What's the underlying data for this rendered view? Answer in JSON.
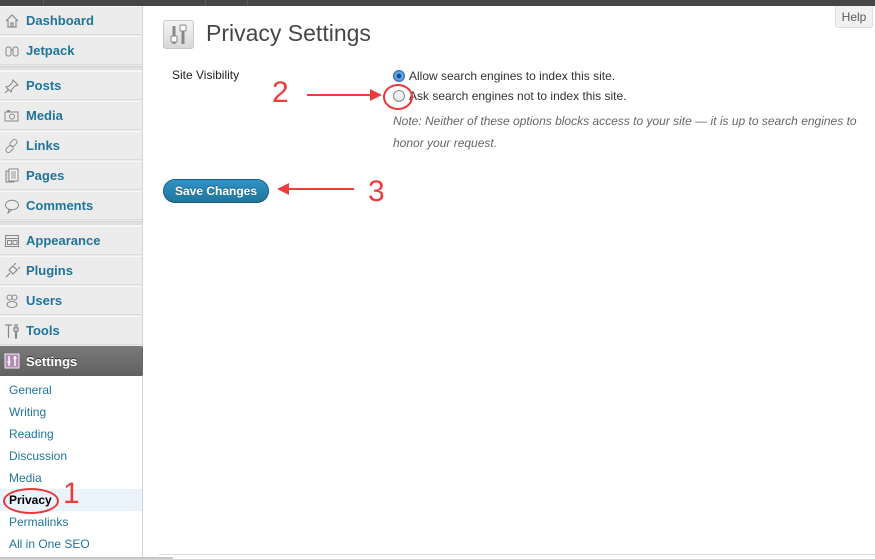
{
  "help_label": "Help",
  "sidebar": {
    "items": [
      {
        "label": "Dashboard",
        "icon": "home-icon"
      },
      {
        "label": "Jetpack",
        "icon": "jetpack-icon"
      },
      {
        "label": "Posts",
        "icon": "pushpin-icon"
      },
      {
        "label": "Media",
        "icon": "camera-icon"
      },
      {
        "label": "Links",
        "icon": "chain-link-icon"
      },
      {
        "label": "Pages",
        "icon": "pages-icon"
      },
      {
        "label": "Comments",
        "icon": "speech-bubble-icon"
      },
      {
        "label": "Appearance",
        "icon": "appearance-icon"
      },
      {
        "label": "Plugins",
        "icon": "plug-icon"
      },
      {
        "label": "Users",
        "icon": "users-icon"
      },
      {
        "label": "Tools",
        "icon": "tools-icon"
      },
      {
        "label": "Settings",
        "icon": "settings-sliders-icon",
        "active": true
      }
    ],
    "submenu": [
      {
        "label": "General"
      },
      {
        "label": "Writing"
      },
      {
        "label": "Reading"
      },
      {
        "label": "Discussion"
      },
      {
        "label": "Media"
      },
      {
        "label": "Privacy",
        "current": true
      },
      {
        "label": "Permalinks"
      },
      {
        "label": "All in One SEO"
      }
    ]
  },
  "page": {
    "title": "Privacy Settings",
    "field_label": "Site Visibility",
    "options": [
      {
        "label": "Allow search engines to index this site.",
        "checked": true
      },
      {
        "label": "Ask search engines not to index this site.",
        "checked": false
      }
    ],
    "note_line1": "Note: Neither of these options blocks access to your site — it is up to search engines to",
    "note_line2": "honor your request.",
    "save_label": "Save Changes"
  },
  "annotations": {
    "step1": "1",
    "step2": "2",
    "step3": "3",
    "color": "#ee3b3b"
  },
  "colors": {
    "link": "#21759b",
    "button": "#21759b",
    "active_menu": "#6a6a6a"
  }
}
